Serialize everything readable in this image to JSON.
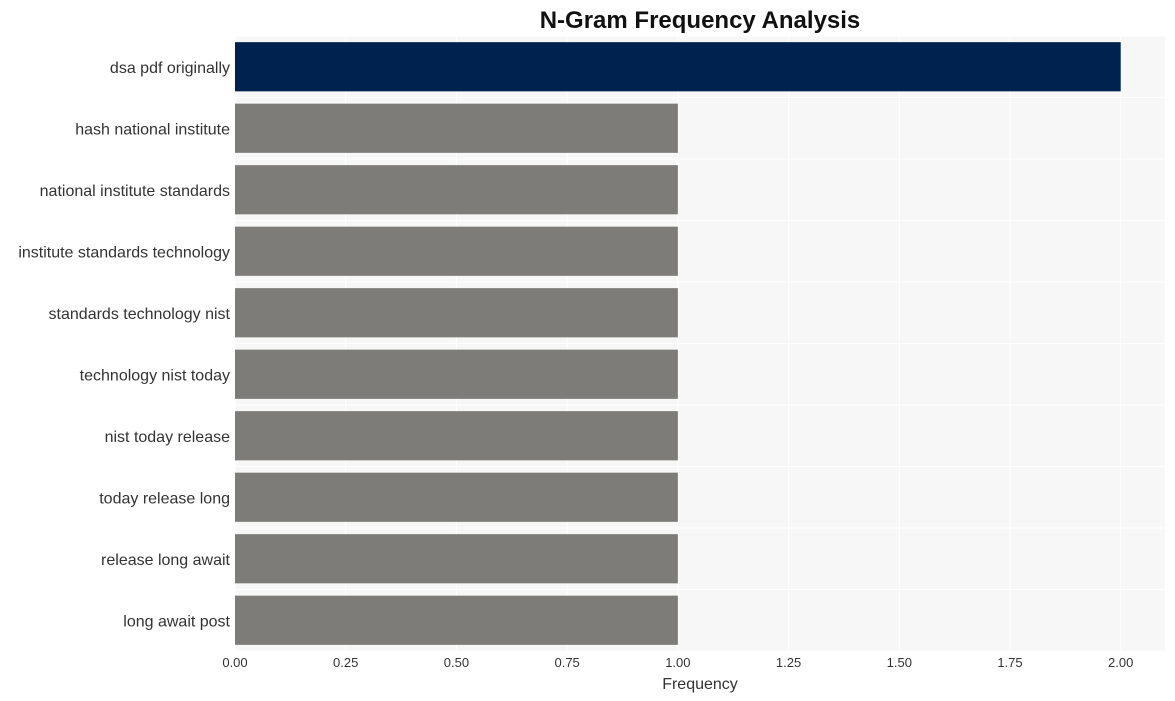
{
  "chart_data": {
    "type": "bar",
    "orientation": "horizontal",
    "title": "N-Gram Frequency Analysis",
    "xlabel": "Frequency",
    "ylabel": "",
    "categories": [
      "dsa pdf originally",
      "hash national institute",
      "national institute standards",
      "institute standards technology",
      "standards technology nist",
      "technology nist today",
      "nist today release",
      "today release long",
      "release long await",
      "long await post"
    ],
    "values": [
      2,
      1,
      1,
      1,
      1,
      1,
      1,
      1,
      1,
      1
    ],
    "highlight_index": 0,
    "colors": {
      "highlight": "#00224e",
      "default": "#7d7c78",
      "plot_bg": "#f7f7f7",
      "grid": "#ffffff"
    },
    "xlim": [
      0,
      2.1
    ],
    "xticks": [
      "0.00",
      "0.25",
      "0.50",
      "0.75",
      "1.00",
      "1.25",
      "1.50",
      "1.75",
      "2.00"
    ],
    "xtick_values": [
      0,
      0.25,
      0.5,
      0.75,
      1.0,
      1.25,
      1.5,
      1.75,
      2.0
    ],
    "grid": true,
    "legend": "none"
  }
}
